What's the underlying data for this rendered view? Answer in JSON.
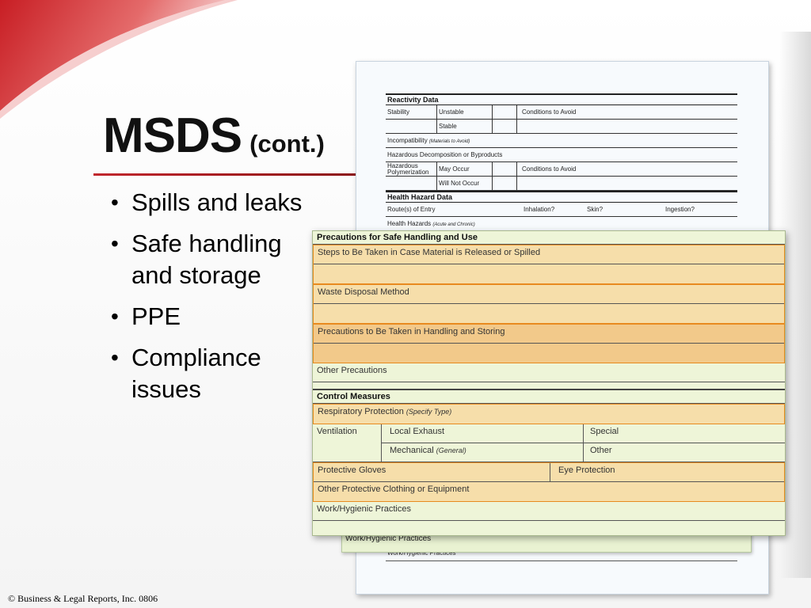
{
  "slide": {
    "title_main": "MSDS",
    "title_sub": "(cont.)",
    "bullets": [
      "Spills and leaks",
      "Safe handling and storage",
      "PPE",
      "Compliance issues"
    ],
    "footer": "© Business & Legal Reports, Inc. 0806",
    "accent_color": "#c1272d"
  },
  "back_form": {
    "reactivity_title": "Reactivity Data",
    "stability": "Stability",
    "unstable": "Unstable",
    "stable": "Stable",
    "conditions_to_avoid": "Conditions to Avoid",
    "incompatibility": "Incompatibility",
    "incompatibility_note": "(Materials to Avoid)",
    "hazardous_decomposition": "Hazardous Decomposition or Byproducts",
    "hazardous_polymerization": "Hazardous Polymerization",
    "may_occur": "May Occur",
    "will_not_occur": "Will Not Occur",
    "health_title": "Health Hazard Data",
    "routes_of_entry": "Route(s) of Entry",
    "inhalation": "Inhalation?",
    "skin": "Skin?",
    "ingestion": "Ingestion?",
    "health_hazards": "Health Hazards",
    "health_hazards_note": "(Acute and Chronic)",
    "bottom_text": "Work/Hygienic Practices"
  },
  "mid_sheet": {
    "text": "Work/Hygienic Practices"
  },
  "front_form": {
    "precautions_title": "Precautions for Safe Handling and Use",
    "steps_spilled": "Steps to Be Taken in Case Material is Released or Spilled",
    "waste_disposal": "Waste Disposal Method",
    "handling_storing": "Precautions to Be Taken in Handling and Storing",
    "other_precautions": "Other Precautions",
    "control_title": "Control Measures",
    "respiratory": "Respiratory Protection",
    "respiratory_note": "(Specify Type)",
    "ventilation": "Ventilation",
    "local_exhaust": "Local Exhaust",
    "special": "Special",
    "mechanical": "Mechanical",
    "mechanical_note": "(General)",
    "other": "Other",
    "protective_gloves": "Protective Gloves",
    "eye_protection": "Eye Protection",
    "other_clothing": "Other Protective Clothing or Equipment",
    "work_practices": "Work/Hygienic Practices",
    "highlight_color": "#e88a1f"
  }
}
